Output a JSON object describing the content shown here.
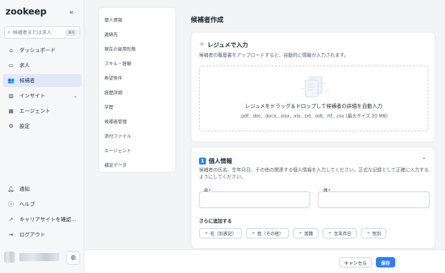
{
  "app": {
    "logo": "zookeep"
  },
  "sidebar": {
    "search_placeholder": "候補者または求人",
    "search_shortcut": "⌘K",
    "items": [
      {
        "label": "ダッシュボード",
        "icon": "home-icon"
      },
      {
        "label": "求人",
        "icon": "briefcase-icon"
      },
      {
        "label": "候補者",
        "icon": "users-icon",
        "active": true
      },
      {
        "label": "インサイト",
        "icon": "chart-icon",
        "expandable": true
      },
      {
        "label": "エージェント",
        "icon": "building-icon"
      },
      {
        "label": "設定",
        "icon": "gear-icon"
      }
    ],
    "bottom_items": [
      {
        "label": "通知",
        "icon": "bell-icon"
      },
      {
        "label": "ヘルプ",
        "icon": "help-icon"
      },
      {
        "label": "キャリアサイトを確認...",
        "icon": "external-link-icon"
      },
      {
        "label": "ログアウト",
        "icon": "logout-icon"
      }
    ]
  },
  "sections": [
    "個人情報",
    "連絡先",
    "現在の雇用形態",
    "スキル・経験",
    "希望条件",
    "経歴詳細",
    "学歴",
    "候補者管理",
    "添付ファイル",
    "エージェント",
    "補足データ"
  ],
  "main": {
    "title": "候補者作成",
    "resume": {
      "title": "レジュメで入力",
      "description": "候補者の履歴書をアップロードすると、自動的に情報が入力されます。",
      "drop_title": "レジュメをドラッグ＆ドロップして候補者の詳細を自動入力",
      "drop_formats": ".pdf, .doc, .docx, .xlsx, .xls, .txt, .odt, .rtf, .csv (最大サイズ 20 MB)"
    },
    "personal": {
      "number": "1",
      "title": "個人情報",
      "description": "候補者の氏名、生年月日、その他の関連する個人情報を入力してください。正式な記録として正確に入力するようにしてください。",
      "first_name_label": "名",
      "last_name_label": "姓",
      "required_mark": "*",
      "add_more_label": "さらに追加する",
      "add_chips": [
        "名（別表記）",
        "姓（その他）",
        "国籍",
        "生年月日",
        "性別"
      ]
    }
  },
  "footer": {
    "cancel_label": "キャンセル",
    "save_label": "保存"
  },
  "colors": {
    "accent": "#2f80ed",
    "active_bg": "#e3e8f7",
    "required": "#e11d48"
  }
}
